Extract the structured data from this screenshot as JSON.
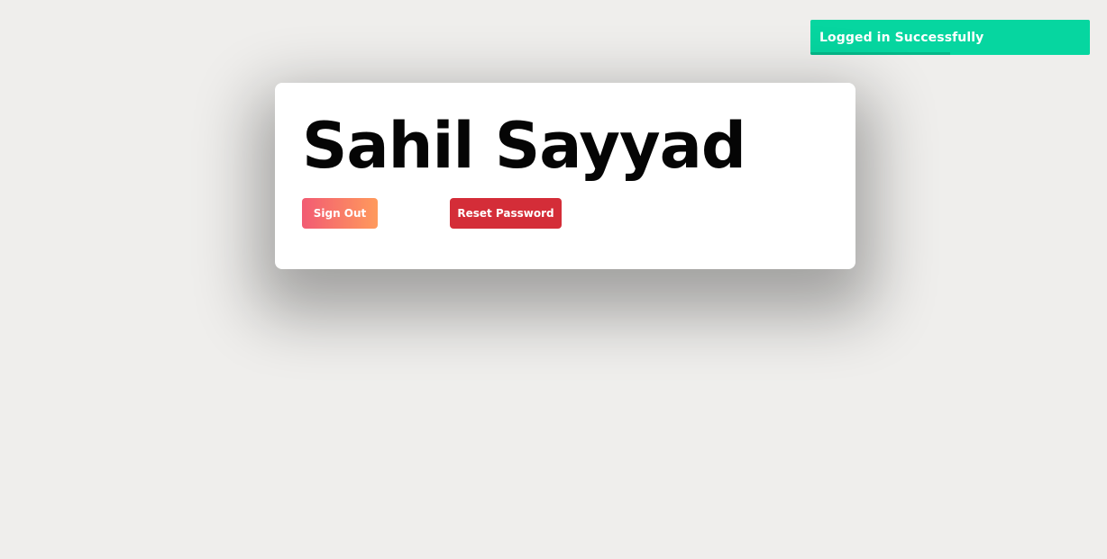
{
  "toast": {
    "message": "Logged in Successfully",
    "progress": 0.5,
    "color": "#06d6a0"
  },
  "card": {
    "user_name": "Sahil Sayyad",
    "sign_out_label": "Sign Out",
    "reset_password_label": "Reset Password"
  },
  "colors": {
    "background": "#efeeec",
    "sign_out_gradient_start": "#f25b73",
    "sign_out_gradient_end": "#ff9a5c",
    "reset_button": "#d42d38"
  }
}
